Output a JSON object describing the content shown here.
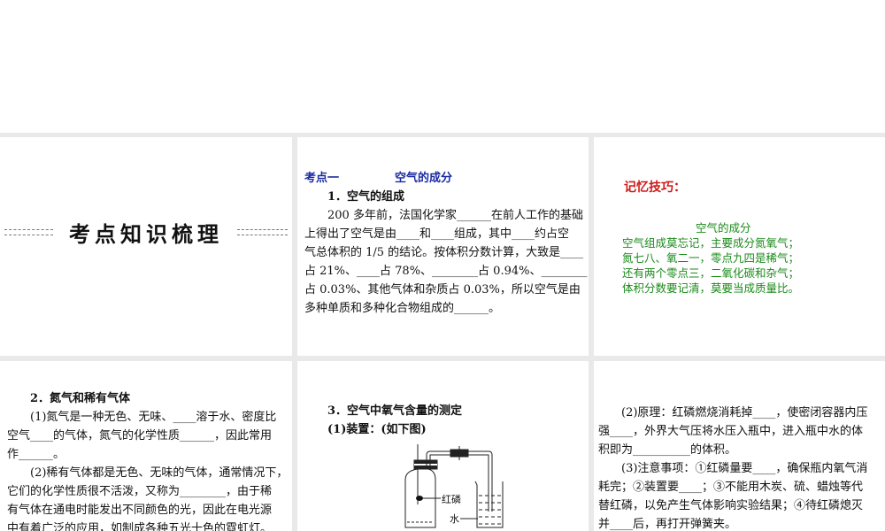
{
  "slide1": {
    "title": "考点知识梳理"
  },
  "slide2": {
    "heading_left": "考点一",
    "heading_right": "空气的成分",
    "lines": [
      "1．空气的组成",
      "200 多年前，法国化学家______在前人工作的基础",
      "上得出了空气是由____和____组成，其中____约占空",
      "气总体积的 1/5 的结论。按体积分数计算，大致是____",
      "占 21%、____占 78%、________占 0.94%、________",
      "占  0.03%、其他气体和杂质占  0.03%，所以空气是由",
      "多种单质和多种化合物组成的______。"
    ]
  },
  "slide3": {
    "label": "记忆技巧：",
    "poem_title": "空气的成分",
    "poem": [
      "空气组成莫忘记，主要成分氮氧气；",
      "氮七八、氧二一，零点九四是稀气；",
      "还有两个零点三，二氧化碳和杂气；",
      "体积分数要记清，莫要当成质量比。"
    ]
  },
  "slide4": {
    "lines": [
      "2．氮气和稀有气体",
      "(1)氮气是一种无色、无味、____溶于水、密度比",
      "空气____的气体，氮气的化学性质______，因此常用",
      "作______。",
      "(2)稀有气体都是无色、无味的气体，通常情况下，",
      "它们的化学性质很不活泼，又称为________，由于稀",
      "有气体在通电时能发出不同颜色的光，因此在电光源",
      "中有着广泛的应用，如制成各种五光十色的霓虹灯。"
    ]
  },
  "slide5": {
    "lines": [
      "3．空气中氧气含量的测定",
      "(1)装置：(如下图)"
    ],
    "label_phosphorus": "红磷",
    "label_water": "水"
  },
  "slide6": {
    "lines": [
      "(2)原理：红磷燃烧消耗掉____，使密闭容器内压",
      "强____，外界大气压将水压入瓶中，进入瓶中水的体",
      "积即为__________的体积。",
      "(3)注意事项：①红磷量要____，确保瓶内氧气消",
      "耗完；②装置要____；③不能用木炭、硫、蜡烛等代",
      "替红磷，以免产生气体影响实验结果；④待红磷熄灭",
      "并____后，再打开弹簧夹。"
    ]
  }
}
